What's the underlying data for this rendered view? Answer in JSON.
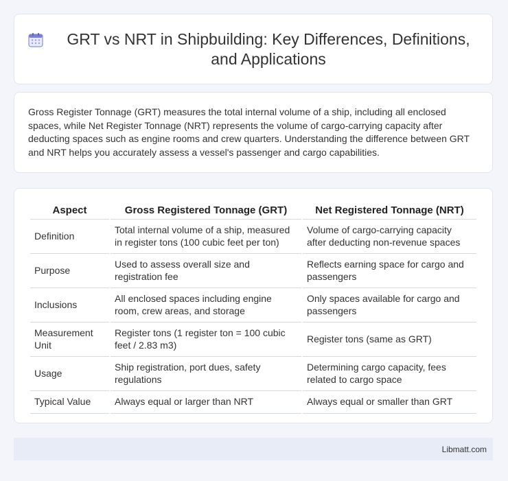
{
  "header": {
    "icon": "calendar-icon",
    "title": "GRT vs NRT in Shipbuilding: Key Differences, Definitions, and Applications"
  },
  "intro": {
    "text": "Gross Register Tonnage (GRT) measures the total internal volume of a ship, including all enclosed spaces, while Net Register Tonnage (NRT) represents the volume of cargo-carrying capacity after deducting spaces such as engine rooms and crew quarters. Understanding the difference between GRT and NRT helps you accurately assess a vessel's passenger and cargo capabilities."
  },
  "table": {
    "headers": [
      "Aspect",
      "Gross Registered Tonnage (GRT)",
      "Net Registered Tonnage (NRT)"
    ],
    "rows": [
      [
        "Definition",
        "Total internal volume of a ship, measured in register tons (100 cubic feet per ton)",
        "Volume of cargo-carrying capacity after deducting non-revenue spaces"
      ],
      [
        "Purpose",
        "Used to assess overall size and registration fee",
        "Reflects earning space for cargo and passengers"
      ],
      [
        "Inclusions",
        "All enclosed spaces including engine room, crew areas, and storage",
        "Only spaces available for cargo and passengers"
      ],
      [
        "Measurement Unit",
        "Register tons (1 register ton = 100 cubic feet / 2.83 m3)",
        "Register tons (same as GRT)"
      ],
      [
        "Usage",
        "Ship registration, port dues, safety regulations",
        "Determining cargo capacity, fees related to cargo space"
      ],
      [
        "Typical Value",
        "Always equal or larger than NRT",
        "Always equal or smaller than GRT"
      ]
    ]
  },
  "footer": {
    "brand": "Libmatt.com"
  },
  "colors": {
    "background": "#f3f5fa",
    "card": "#ffffff",
    "footer": "#e8ecf7",
    "icon_accent": "#7b7fd6"
  }
}
